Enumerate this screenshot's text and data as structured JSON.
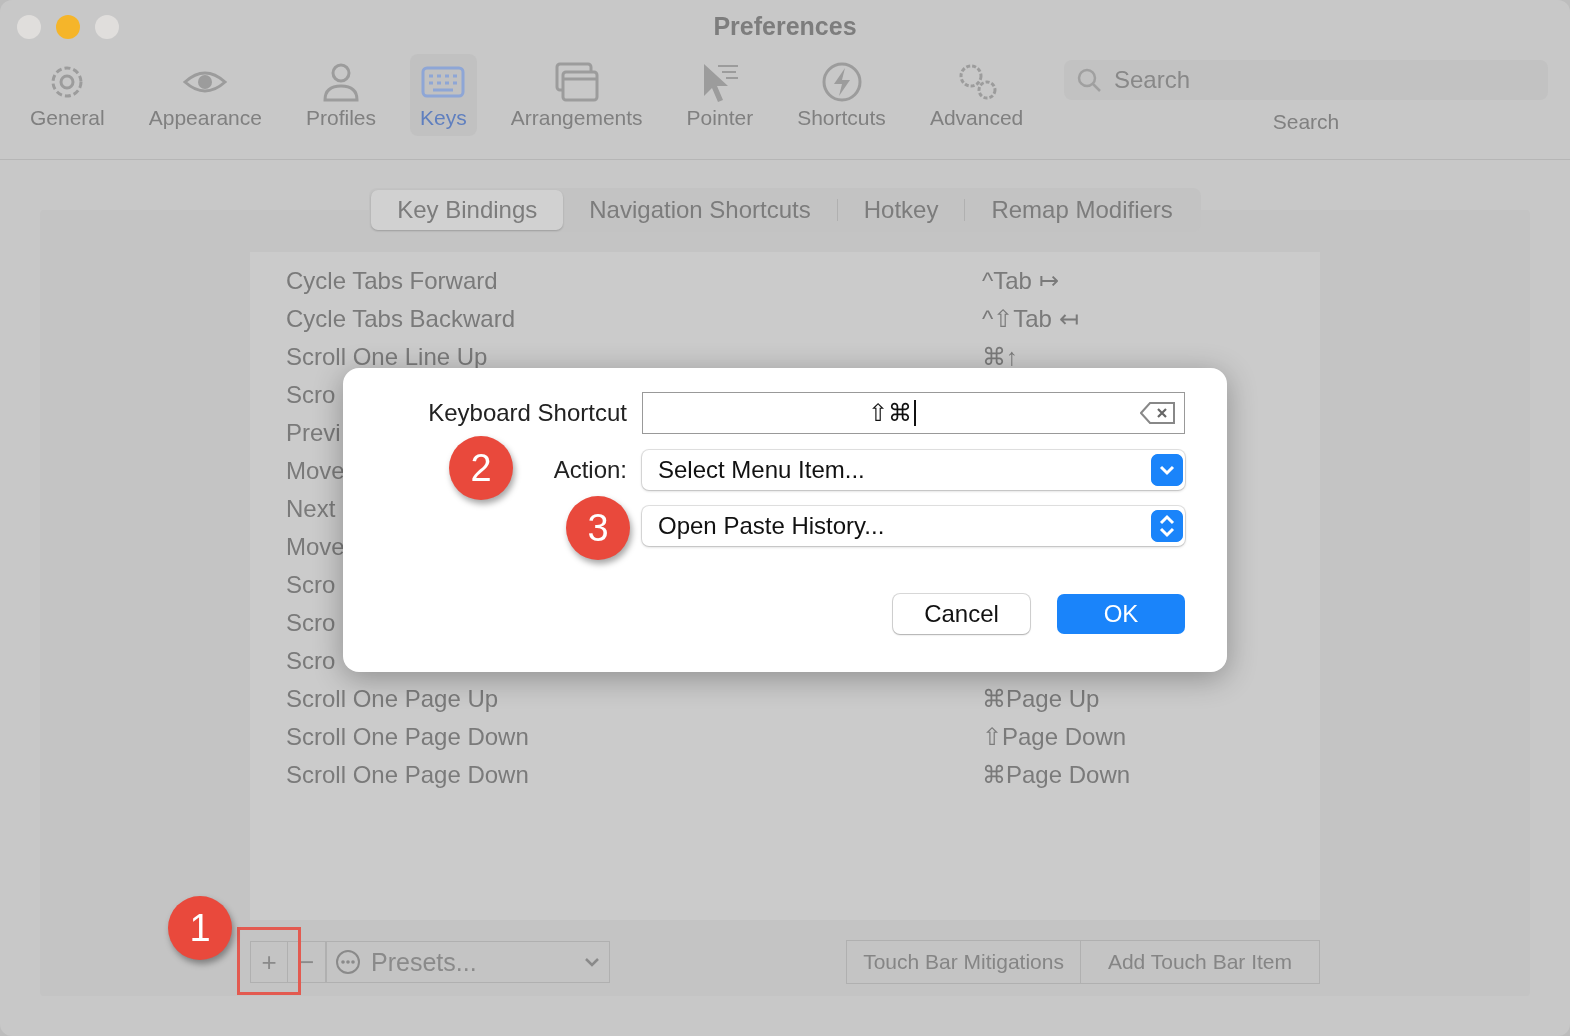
{
  "window": {
    "title": "Preferences"
  },
  "toolbar": [
    {
      "label": "General",
      "selected": false
    },
    {
      "label": "Appearance",
      "selected": false
    },
    {
      "label": "Profiles",
      "selected": false
    },
    {
      "label": "Keys",
      "selected": true
    },
    {
      "label": "Arrangements",
      "selected": false
    },
    {
      "label": "Pointer",
      "selected": false
    },
    {
      "label": "Shortcuts",
      "selected": false
    },
    {
      "label": "Advanced",
      "selected": false
    }
  ],
  "search": {
    "placeholder": "Search",
    "label": "Search"
  },
  "tabs": [
    {
      "label": "Key Bindings",
      "selected": true
    },
    {
      "label": "Navigation Shortcuts",
      "selected": false
    },
    {
      "label": "Hotkey",
      "selected": false
    },
    {
      "label": "Remap Modifiers",
      "selected": false
    }
  ],
  "bindings": [
    {
      "action": "Cycle Tabs Forward",
      "shortcut": "^Tab ↦"
    },
    {
      "action": "Cycle Tabs Backward",
      "shortcut": "^⇧Tab ↤"
    },
    {
      "action": "Scroll One Line Up",
      "shortcut": "⌘↑"
    },
    {
      "action": "Scro"
    },
    {
      "action": "Previ"
    },
    {
      "action": "Move"
    },
    {
      "action": "Next"
    },
    {
      "action": "Move"
    },
    {
      "action": "Scro"
    },
    {
      "action": "Scro"
    },
    {
      "action": "Scro"
    },
    {
      "action": "Scroll One Page Up",
      "shortcut": "⌘Page Up"
    },
    {
      "action": "Scroll One Page Down",
      "shortcut": "⇧Page Down"
    },
    {
      "action": "Scroll One Page Down",
      "shortcut": "⌘Page Down"
    }
  ],
  "footer": {
    "add": "+",
    "remove": "−",
    "presets": "Presets...",
    "buttons": [
      "Touch Bar Mitigations",
      "Add Touch Bar Item"
    ]
  },
  "dialog": {
    "shortcut_label": "Keyboard Shortcut",
    "shortcut_value": "⇧⌘",
    "action_label": "Action:",
    "action": "Select Menu Item...",
    "menu_item": "Open Paste History...",
    "buttons": [
      {
        "label": "Cancel",
        "kind": "secondary"
      },
      {
        "label": "OK",
        "kind": "primary"
      }
    ]
  },
  "annotations": [
    {
      "label": "1"
    },
    {
      "label": "2"
    },
    {
      "label": "3"
    }
  ]
}
